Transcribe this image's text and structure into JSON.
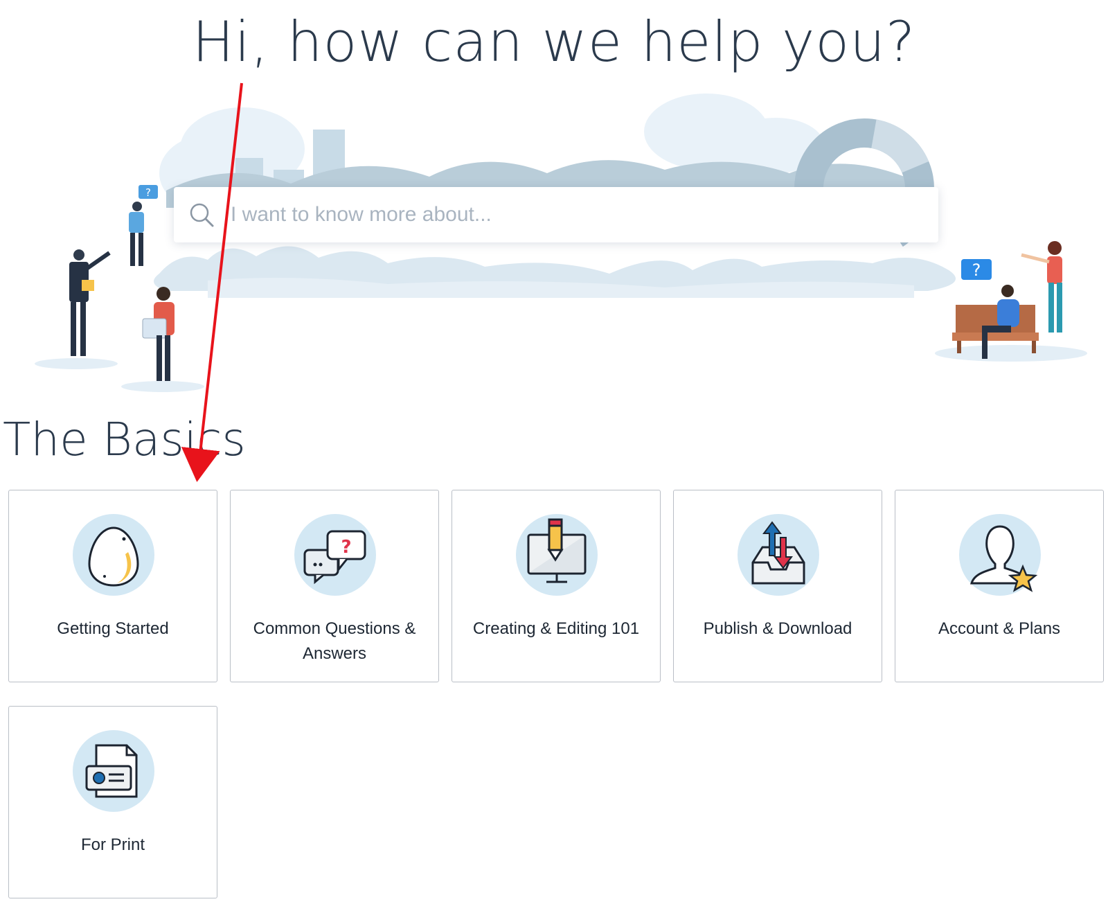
{
  "hero": {
    "title": "Hi, how can we help you?"
  },
  "search": {
    "placeholder": "I want to know more about...",
    "value": ""
  },
  "section": {
    "title": "The Basics"
  },
  "cards": [
    {
      "label": "Getting Started",
      "icon": "egg-icon"
    },
    {
      "label": "Common Questions & Answers",
      "icon": "chat-question-icon"
    },
    {
      "label": "Creating & Editing 101",
      "icon": "monitor-pencil-icon"
    },
    {
      "label": "Publish & Download",
      "icon": "inbox-arrows-icon"
    },
    {
      "label": "Account & Plans",
      "icon": "user-star-icon"
    },
    {
      "label": "For Print",
      "icon": "id-card-document-icon"
    }
  ],
  "illustration": {
    "bubble_left": "?",
    "bubble_right": "?"
  },
  "colors": {
    "icon_circle": "#d3e8f4",
    "heading": "#2b3a4c",
    "annotation_arrow": "#e8131b",
    "accent_yellow": "#f6c34a",
    "accent_red": "#e0334a",
    "accent_blue": "#1f6fb2"
  }
}
